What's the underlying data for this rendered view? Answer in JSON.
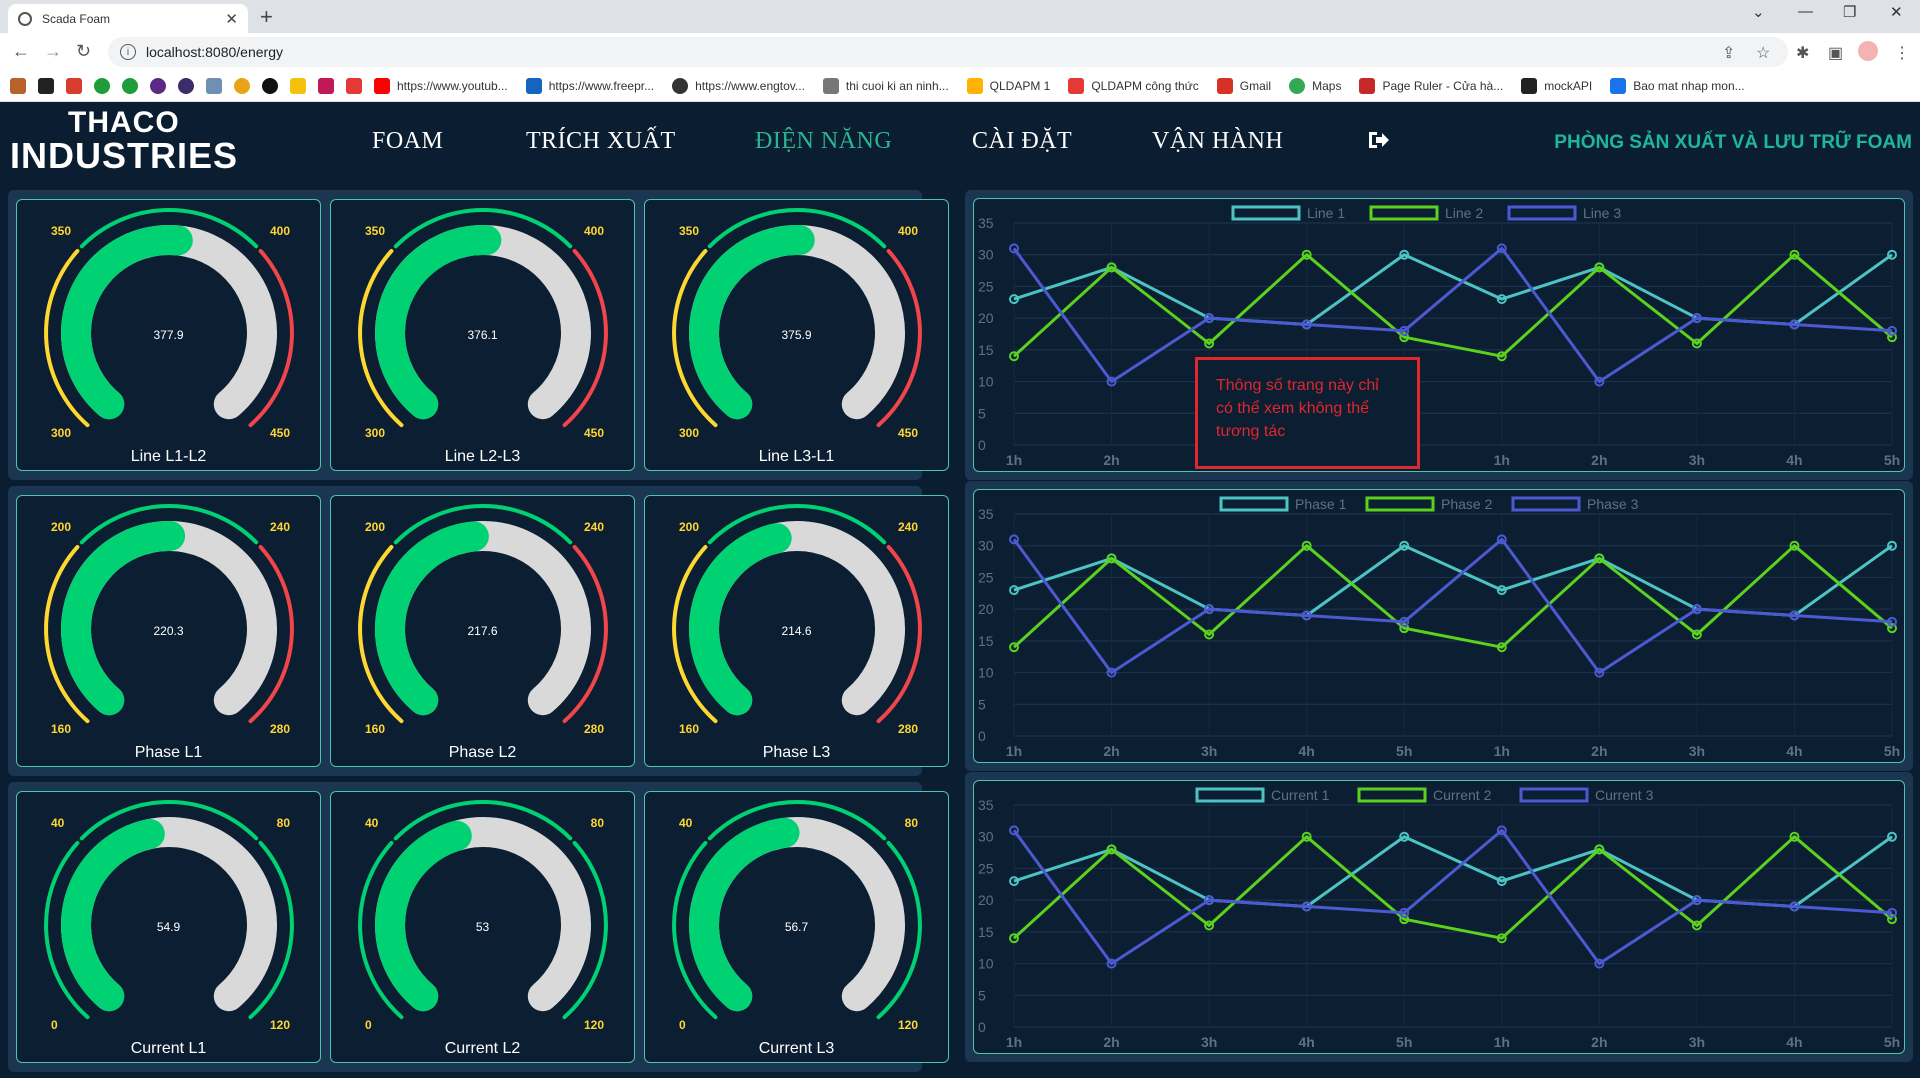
{
  "browser": {
    "tab_title": "Scada Foam",
    "url": "localhost:8080/energy",
    "bookmarks": [
      {
        "label": "https://www.youtub...",
        "color": "#ff0000"
      },
      {
        "label": "https://www.freepr...",
        "color": "#1565c0"
      },
      {
        "label": "https://www.engtov...",
        "color": "#333333"
      },
      {
        "label": "thi cuoi ki an ninh...",
        "color": "#777777"
      },
      {
        "label": "QLDAPM 1",
        "color": "#ffb300"
      },
      {
        "label": "QLDAPM công thức",
        "color": "#e53935"
      },
      {
        "label": "Gmail",
        "color": "#d93025"
      },
      {
        "label": "Maps",
        "color": "#34a853"
      },
      {
        "label": "Page Ruler - Cửa hà...",
        "color": "#c62828"
      },
      {
        "label": "mockAPI",
        "color": "#222222"
      },
      {
        "label": "Bao mat nhap mon...",
        "color": "#1a73e8"
      }
    ]
  },
  "header": {
    "logo_line1": "THACO",
    "logo_line2": "INDUSTRIES",
    "menu": [
      "FOAM",
      "TRÍCH XUẤT",
      "ĐIỆN NĂNG",
      "CÀI ĐẶT",
      "VẬN HÀNH"
    ],
    "active_menu": "ĐIỆN NĂNG",
    "department": "PHÒNG SẢN XUẤT VÀ LƯU TRỮ FOAM"
  },
  "colors": {
    "bg": "#0b1d31",
    "panel": "#1b3651",
    "accent": "#2bb592",
    "gauge_fill": "#00d173",
    "gauge_track": "#d9d9d9",
    "zone_low": "#ffd731",
    "zone_high": "#f0454a",
    "zone_ok": "#00d173",
    "line1": "#4cc4c4",
    "line2": "#5ad21e",
    "line3": "#4b5ad1"
  },
  "gauges": [
    {
      "label": "Line L1-L2",
      "value": 377.9,
      "display": "377.9",
      "min": 300,
      "max": 450,
      "zone_min": 350,
      "zone_max": 400,
      "zones": "warn"
    },
    {
      "label": "Line L2-L3",
      "value": 376.1,
      "display": "376.1",
      "min": 300,
      "max": 450,
      "zone_min": 350,
      "zone_max": 400,
      "zones": "warn"
    },
    {
      "label": "Line L3-L1",
      "value": 375.9,
      "display": "375.9",
      "min": 300,
      "max": 450,
      "zone_min": 350,
      "zone_max": 400,
      "zones": "warn"
    },
    {
      "label": "Phase L1",
      "value": 220.3,
      "display": "220.3",
      "min": 160,
      "max": 280,
      "zone_min": 200,
      "zone_max": 240,
      "zones": "warn"
    },
    {
      "label": "Phase L2",
      "value": 217.6,
      "display": "217.6",
      "min": 160,
      "max": 280,
      "zone_min": 200,
      "zone_max": 240,
      "zones": "warn"
    },
    {
      "label": "Phase L3",
      "value": 214.6,
      "display": "214.6",
      "min": 160,
      "max": 280,
      "zone_min": 200,
      "zone_max": 240,
      "zones": "warn"
    },
    {
      "label": "Current L1",
      "value": 54.9,
      "display": "54.9",
      "min": 0,
      "max": 120,
      "zone_min": 40,
      "zone_max": 80,
      "zones": "ok"
    },
    {
      "label": "Current L2",
      "value": 53,
      "display": "53",
      "min": 0,
      "max": 120,
      "zone_min": 40,
      "zone_max": 80,
      "zones": "ok"
    },
    {
      "label": "Current L3",
      "value": 56.7,
      "display": "56.7",
      "min": 0,
      "max": 120,
      "zone_min": 40,
      "zone_max": 80,
      "zones": "ok"
    }
  ],
  "chart_data": [
    {
      "type": "line",
      "x": [
        "1h",
        "2h",
        "3h",
        "4h",
        "5h",
        "1h",
        "2h",
        "3h",
        "4h",
        "5h"
      ],
      "ylim": [
        0,
        35
      ],
      "yticks": [
        0,
        5,
        10,
        15,
        20,
        25,
        30,
        35
      ],
      "legend": "top-center",
      "grid": true,
      "series": [
        {
          "name": "Line 1",
          "values": [
            23,
            28,
            20,
            19,
            30,
            23,
            28,
            20,
            19,
            30
          ]
        },
        {
          "name": "Line 2",
          "values": [
            14,
            28,
            16,
            30,
            17,
            14,
            28,
            16,
            30,
            17
          ]
        },
        {
          "name": "Line 3",
          "values": [
            31,
            10,
            20,
            19,
            18,
            31,
            10,
            20,
            19,
            18
          ]
        }
      ]
    },
    {
      "type": "line",
      "x": [
        "1h",
        "2h",
        "3h",
        "4h",
        "5h",
        "1h",
        "2h",
        "3h",
        "4h",
        "5h"
      ],
      "ylim": [
        0,
        35
      ],
      "yticks": [
        0,
        5,
        10,
        15,
        20,
        25,
        30,
        35
      ],
      "legend": "top-center",
      "grid": true,
      "series": [
        {
          "name": "Phase 1",
          "values": [
            23,
            28,
            20,
            19,
            30,
            23,
            28,
            20,
            19,
            30
          ]
        },
        {
          "name": "Phase 2",
          "values": [
            14,
            28,
            16,
            30,
            17,
            14,
            28,
            16,
            30,
            17
          ]
        },
        {
          "name": "Phase 3",
          "values": [
            31,
            10,
            20,
            19,
            18,
            31,
            10,
            20,
            19,
            18
          ]
        }
      ]
    },
    {
      "type": "line",
      "x": [
        "1h",
        "2h",
        "3h",
        "4h",
        "5h",
        "1h",
        "2h",
        "3h",
        "4h",
        "5h"
      ],
      "ylim": [
        0,
        35
      ],
      "yticks": [
        0,
        5,
        10,
        15,
        20,
        25,
        30,
        35
      ],
      "legend": "top-center",
      "grid": true,
      "series": [
        {
          "name": "Current 1",
          "values": [
            23,
            28,
            20,
            19,
            30,
            23,
            28,
            20,
            19,
            30
          ]
        },
        {
          "name": "Current 2",
          "values": [
            14,
            28,
            16,
            30,
            17,
            14,
            28,
            16,
            30,
            17
          ]
        },
        {
          "name": "Current 3",
          "values": [
            31,
            10,
            20,
            19,
            18,
            31,
            10,
            20,
            19,
            18
          ]
        }
      ]
    }
  ],
  "note": "Thông số trang này chỉ có thể xem không thể tương tác"
}
